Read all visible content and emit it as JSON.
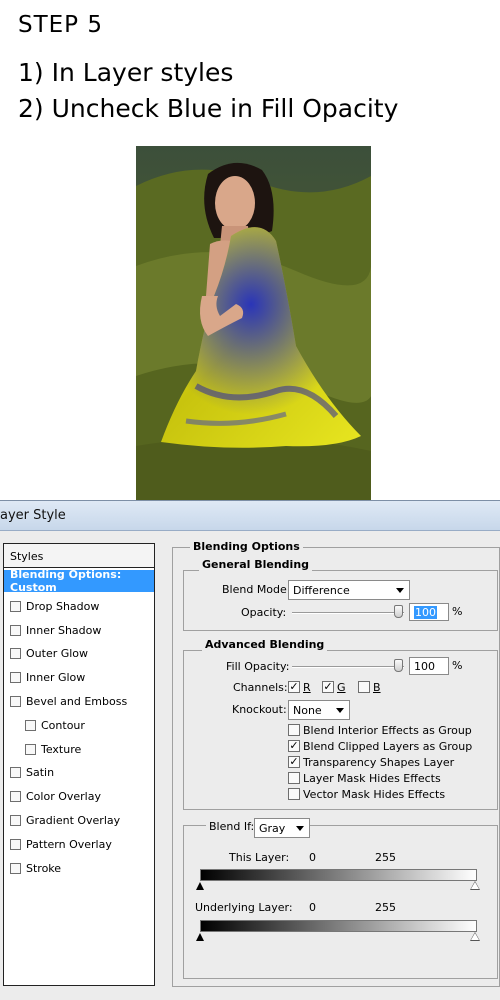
{
  "header": {
    "step": "STEP  5",
    "instruction_1": "1) In Layer styles",
    "instruction_2": "2) Uncheck Blue in Fill Opacity"
  },
  "dialog": {
    "title": "ayer Style",
    "styles_header": "Styles",
    "styles": [
      {
        "label": "Blending Options: Custom",
        "active": true
      },
      {
        "label": "Drop Shadow",
        "checked": false
      },
      {
        "label": "Inner Shadow",
        "checked": false
      },
      {
        "label": "Outer Glow",
        "checked": false
      },
      {
        "label": "Inner Glow",
        "checked": false
      },
      {
        "label": "Bevel and Emboss",
        "checked": false
      },
      {
        "label": "Contour",
        "checked": false
      },
      {
        "label": "Texture",
        "checked": false
      },
      {
        "label": "Satin",
        "checked": false
      },
      {
        "label": "Color Overlay",
        "checked": false
      },
      {
        "label": "Gradient Overlay",
        "checked": false
      },
      {
        "label": "Pattern Overlay",
        "checked": false
      },
      {
        "label": "Stroke",
        "checked": false
      }
    ],
    "blending_options": {
      "title": "Blending Options",
      "general": {
        "title": "General Blending",
        "blend_mode_label": "Blend Mode:",
        "blend_mode_value": "Difference",
        "opacity_label": "Opacity:",
        "opacity_value": "100",
        "percent": "%"
      },
      "advanced": {
        "title": "Advanced Blending",
        "fill_opacity_label": "Fill Opacity:",
        "fill_opacity_value": "100",
        "percent": "%",
        "channels_label": "Channels:",
        "channel_r": "R",
        "channel_g": "G",
        "channel_b": "B",
        "channel_r_checked": true,
        "channel_g_checked": true,
        "channel_b_checked": false,
        "knockout_label": "Knockout:",
        "knockout_value": "None",
        "options": [
          {
            "label": "Blend Interior Effects as Group",
            "checked": false
          },
          {
            "label": "Blend Clipped Layers as Group",
            "checked": true
          },
          {
            "label": "Transparency Shapes Layer",
            "checked": true
          },
          {
            "label": "Layer Mask Hides Effects",
            "checked": false
          },
          {
            "label": "Vector Mask Hides Effects",
            "checked": false
          }
        ]
      },
      "blend_if": {
        "label": "Blend If:",
        "value": "Gray",
        "this_layer_label": "This Layer:",
        "this_layer_min": "0",
        "this_layer_max": "255",
        "underlying_label": "Underlying Layer:",
        "underlying_min": "0",
        "underlying_max": "255"
      }
    }
  }
}
